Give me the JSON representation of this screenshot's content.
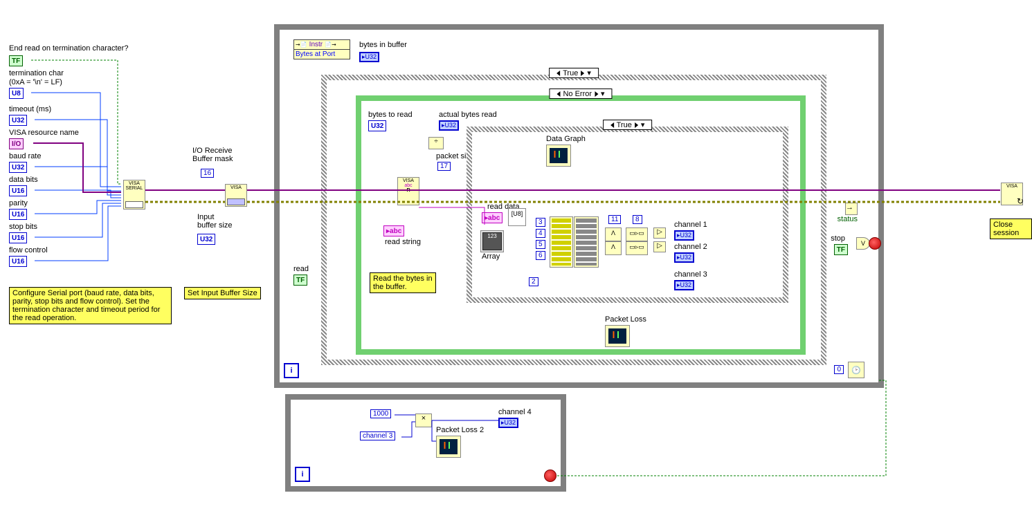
{
  "controls": {
    "endRead": {
      "label": "End read on termination character?",
      "type": "TF"
    },
    "termChar": {
      "label1": "termination char",
      "label2": "(0xA = '\\n' = LF)",
      "type": "U8"
    },
    "timeout": {
      "label": "timeout (ms)",
      "type": "U32"
    },
    "visaRes": {
      "label": "VISA resource name",
      "type": "I/O"
    },
    "baud": {
      "label": "baud rate",
      "type": "U32"
    },
    "dataBits": {
      "label": "data bits",
      "type": "U16"
    },
    "parity": {
      "label": "parity",
      "type": "U16"
    },
    "stopBits": {
      "label": "stop bits",
      "type": "U16"
    },
    "flowCtrl": {
      "label": "flow control",
      "type": "U16"
    }
  },
  "ioBuf": {
    "label": "I/O Receive\nBuffer mask",
    "const": "16",
    "sizeLabel": "Input\nbuffer size"
  },
  "comments": {
    "configure": "Configure Serial port (baud rate, data bits, parity, stop bits and flow control). Set the termination character and timeout period for the read operation.",
    "setBuf": "Set Input Buffer Size",
    "readBytes": "Read the bytes in the buffer.",
    "close": "Close session"
  },
  "read": {
    "label": "read",
    "type": "TF"
  },
  "prop": {
    "class": "Instr",
    "prop": "Bytes at Port",
    "out": "bytes in buffer",
    "outType": "U32"
  },
  "caseOuter": "True",
  "caseErr": "No Error",
  "caseInner": "True",
  "inCase": {
    "bytesToRead": {
      "label": "bytes to read",
      "type": "U32"
    },
    "actualRead": {
      "label": "actual bytes read",
      "type": "U32"
    },
    "packetSize": {
      "label": "packet size",
      "value": "17"
    },
    "readStringLbl": "read string",
    "readDataLbl": "read data",
    "arrayLbl": "Array",
    "dataGraph": "Data Graph",
    "packetLoss": "Packet Loss",
    "idx": {
      "a": "3",
      "b": "4",
      "c": "5",
      "d": "6",
      "e": "2",
      "f": "11",
      "g": "8"
    },
    "ch1": "channel 1",
    "ch2": "channel 2",
    "ch3": "channel 3",
    "outType": "U32"
  },
  "stop": {
    "label": "stop",
    "type": "TF"
  },
  "status": "status",
  "zero": "0",
  "loop2": {
    "const1000": "1000",
    "ch3local": "channel 3",
    "pl2": "Packet Loss 2",
    "ch4": "channel 4",
    "outType": "U32"
  }
}
